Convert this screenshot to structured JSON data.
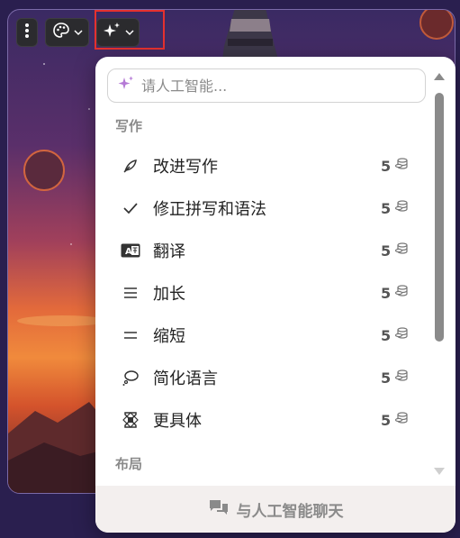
{
  "toolbar": {
    "more_icon": "vertical-dots-icon",
    "style_icon": "palette-icon",
    "ai_icon": "sparkles-icon",
    "chevron": "⌄"
  },
  "ai_menu": {
    "search_placeholder": "请人工智能...",
    "sections": [
      {
        "label": "写作",
        "items": [
          {
            "label": "改进写作",
            "cost": "5",
            "icon": "feather-icon"
          },
          {
            "label": "修正拼写和语法",
            "cost": "5",
            "icon": "check-icon"
          },
          {
            "label": "翻译",
            "cost": "5",
            "icon": "translate-icon"
          },
          {
            "label": "加长",
            "cost": "5",
            "icon": "lines-icon"
          },
          {
            "label": "缩短",
            "cost": "5",
            "icon": "equals-icon"
          },
          {
            "label": "简化语言",
            "cost": "5",
            "icon": "speech-bubble-icon"
          },
          {
            "label": "更具体",
            "cost": "5",
            "icon": "focus-icon"
          }
        ]
      },
      {
        "label": "布局",
        "items": []
      }
    ],
    "footer_label": "与人工智能聊天"
  },
  "colors": {
    "accent_highlight": "#e5312f",
    "panel_bg": "#ffffff",
    "footer_bg": "#f3efee",
    "muted_text": "#8a8a8a"
  }
}
